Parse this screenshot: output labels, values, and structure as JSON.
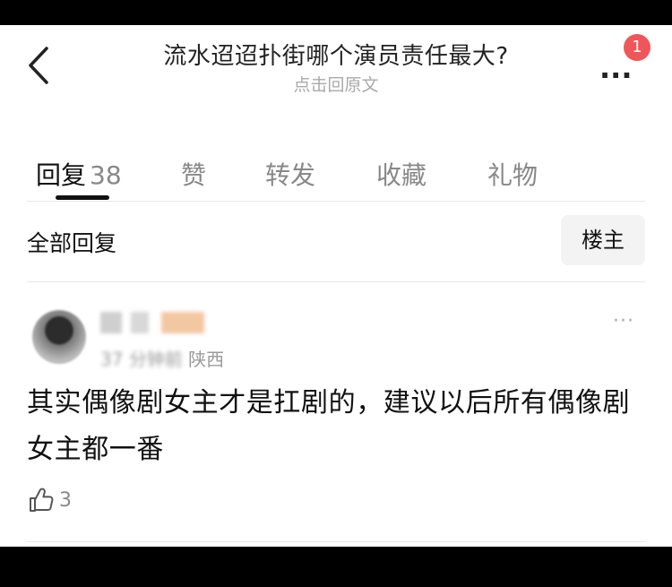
{
  "header": {
    "title": "流水迢迢扑街哪个演员责任最大?",
    "subtitle": "点击回原文",
    "notification_count": "1"
  },
  "tabs": [
    {
      "label": "回复",
      "count": "38",
      "active": true
    },
    {
      "label": "赞"
    },
    {
      "label": "转发"
    },
    {
      "label": "收藏"
    },
    {
      "label": "礼物"
    }
  ],
  "filter": {
    "label": "全部回复",
    "author_button": "楼主"
  },
  "comment": {
    "time_fragment": "37",
    "time_suffix": "分钟前",
    "location": "陕西",
    "text": "其实偶像剧女主才是扛剧的，建议以后所有偶像剧女主都一番",
    "likes": "3",
    "more_icon": "···"
  },
  "colors": {
    "badge": "#f0555a",
    "text_primary": "#111111",
    "text_secondary": "#888888"
  }
}
